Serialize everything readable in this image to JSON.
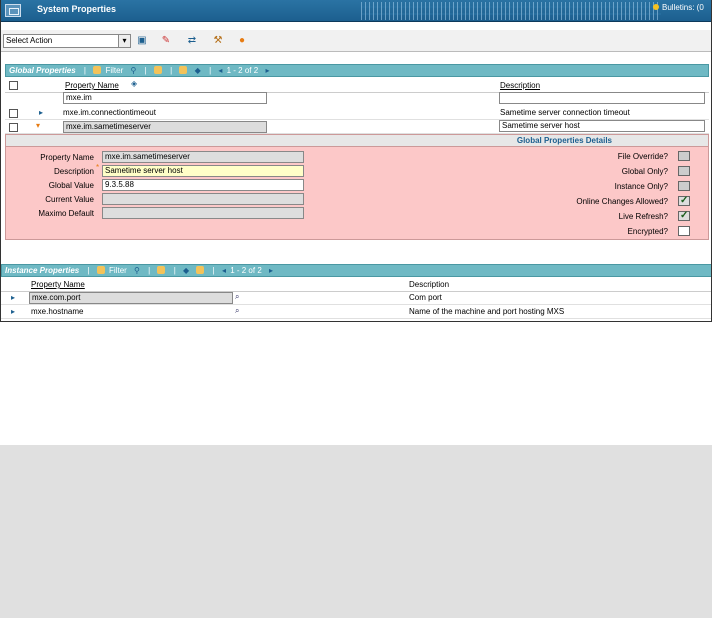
{
  "window": {
    "title": "System Properties",
    "bulletins_label": "Bulletins: (0"
  },
  "toolbar": {
    "select_action": "Select Action",
    "icons": [
      "save-icon",
      "clear-icon",
      "refresh-icon",
      "tools-icon",
      "help-icon"
    ]
  },
  "global_properties": {
    "section_label": "Global Properties",
    "filter_label": "Filter",
    "pagination": "1 - 2 of 2",
    "columns": {
      "property_name": "Property Name",
      "description": "Description"
    },
    "filter_row": {
      "property_name_value": "mxe.im",
      "description_value": ""
    },
    "rows": [
      {
        "property_name": "mxe.im.connectiontimeout",
        "description": "Sametime server connection timeout"
      },
      {
        "property_name": "mxe.im.sametimeserver",
        "description": "Sametime server host"
      }
    ]
  },
  "details": {
    "header": "Global Properties Details",
    "fields": {
      "property_name_label": "Property Name",
      "property_name_value": "mxe.im.sametimeserver",
      "description_label": "Description",
      "description_value": "Sametime server host",
      "global_value_label": "Global Value",
      "global_value_value": "9.3.5.88",
      "current_value_label": "Current Value",
      "current_value_value": "",
      "maximo_default_label": "Maximo Default",
      "maximo_default_value": ""
    },
    "flags": {
      "file_override": "File Override?",
      "global_only": "Global Only?",
      "instance_only": "Instance Only?",
      "online_changes": "Online Changes Allowed?",
      "live_refresh": "Live Refresh?",
      "encrypted": "Encrypted?"
    }
  },
  "instance_properties": {
    "section_label": "Instance Properties",
    "filter_label": "Filter",
    "pagination": "1 - 2 of 2",
    "columns": {
      "property_name": "Property Name",
      "description": "Description"
    },
    "rows": [
      {
        "property_name": "mxe.com.port",
        "description": "Com port"
      },
      {
        "property_name": "mxe.hostname",
        "description": "Name of the machine and port hosting MXS"
      }
    ]
  },
  "colors": {
    "title_bar": "#1c5f8f",
    "section_bar": "#6fb9c4",
    "details_bg": "#fcc8c8",
    "highlight_orange": "#e77c13"
  }
}
